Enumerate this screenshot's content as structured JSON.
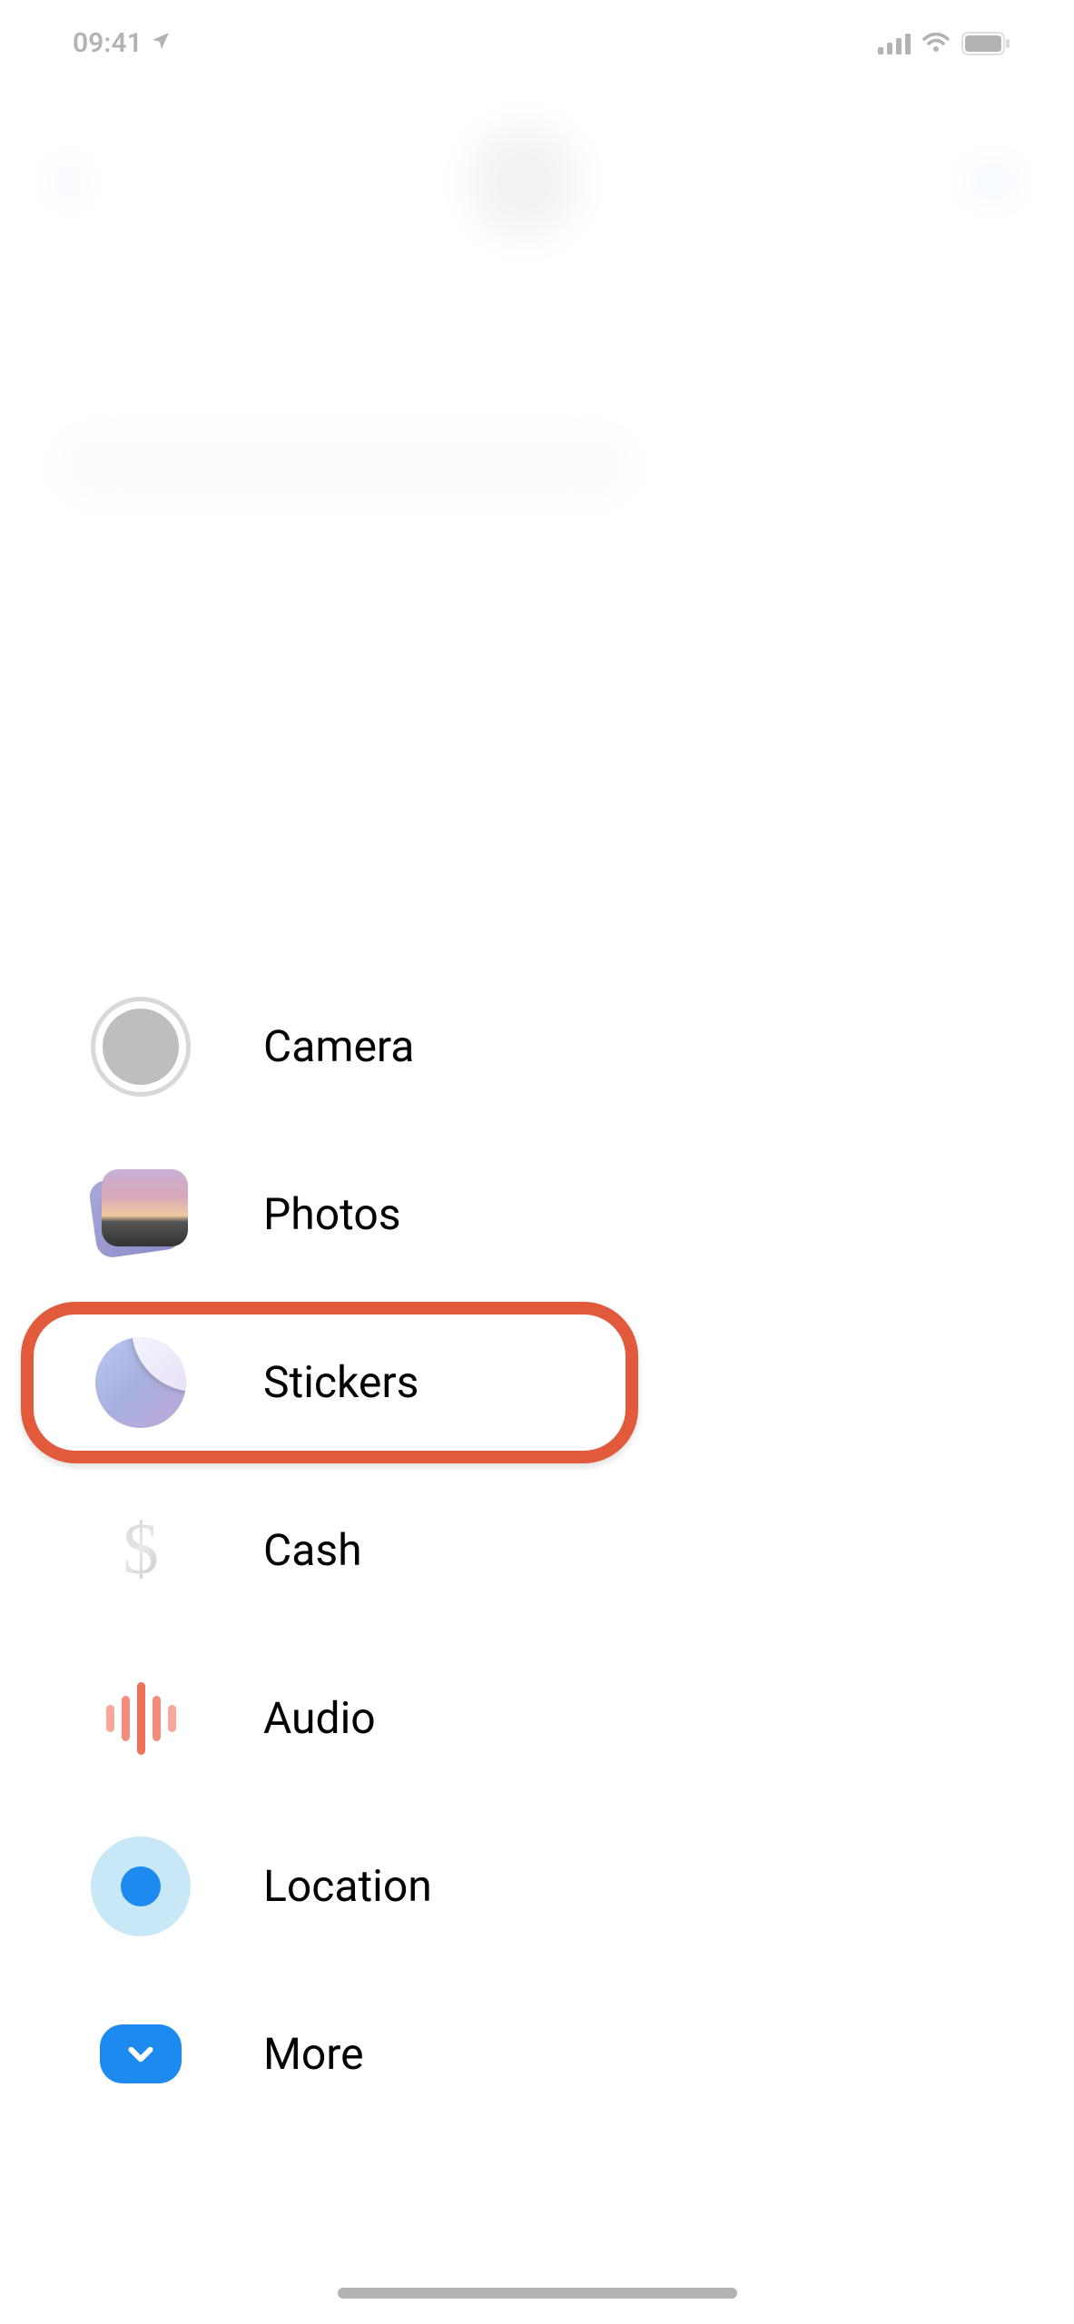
{
  "status_bar": {
    "time": "09:41"
  },
  "menu": {
    "items": [
      {
        "label": "Camera",
        "icon": "camera-icon"
      },
      {
        "label": "Photos",
        "icon": "photos-icon"
      },
      {
        "label": "Stickers",
        "icon": "stickers-icon",
        "highlighted": true
      },
      {
        "label": "Cash",
        "icon": "cash-icon"
      },
      {
        "label": "Audio",
        "icon": "audio-icon"
      },
      {
        "label": "Location",
        "icon": "location-icon"
      },
      {
        "label": "More",
        "icon": "more-icon"
      }
    ]
  },
  "highlight_color": "#e05a3b"
}
